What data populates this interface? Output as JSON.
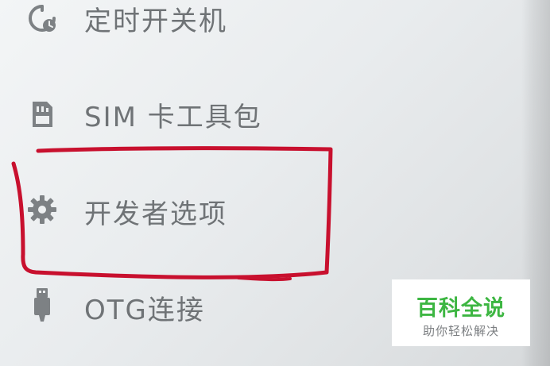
{
  "menu": {
    "items": [
      {
        "label": "定时开关机",
        "icon": "clock-timer-icon"
      },
      {
        "label": "SIM 卡工具包",
        "icon": "sim-card-icon"
      },
      {
        "label": "开发者选项",
        "icon": "gear-icon"
      },
      {
        "label": "OTG连接",
        "icon": "usb-icon"
      }
    ]
  },
  "annotation": {
    "color": "#c8102e",
    "target": "开发者选项"
  },
  "watermark": {
    "title": "百科全说",
    "subtitle": "助你轻松解决",
    "title_color": "#3db642"
  }
}
